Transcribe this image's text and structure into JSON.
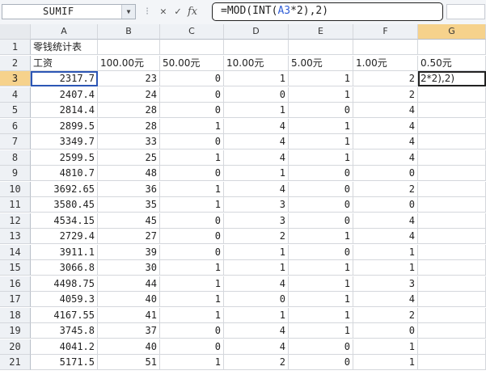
{
  "name_box": "SUMIF",
  "formula_bar": {
    "prefix": "=MOD(INT(",
    "ref": "A3",
    "suffix": "*2),2)",
    "cancel_icon": "x-icon",
    "enter_icon": "check-icon",
    "fx_label": "fx"
  },
  "columns": [
    "A",
    "B",
    "C",
    "D",
    "E",
    "F",
    "G"
  ],
  "active_column": "G",
  "active_row": 3,
  "edit_text": "2*2),2)",
  "rows": [
    {
      "n": "1",
      "cells": [
        "零钱统计表",
        "",
        "",
        "",
        "",
        "",
        ""
      ]
    },
    {
      "n": "2",
      "cells": [
        "工资",
        "100.00元",
        "50.00元",
        "10.00元",
        "5.00元",
        "1.00元",
        "0.50元"
      ]
    },
    {
      "n": "3",
      "cells": [
        "2317.7",
        "23",
        "0",
        "1",
        "1",
        "2",
        ""
      ]
    },
    {
      "n": "4",
      "cells": [
        "2407.4",
        "24",
        "0",
        "0",
        "1",
        "2",
        ""
      ]
    },
    {
      "n": "5",
      "cells": [
        "2814.4",
        "28",
        "0",
        "1",
        "0",
        "4",
        ""
      ]
    },
    {
      "n": "6",
      "cells": [
        "2899.5",
        "28",
        "1",
        "4",
        "1",
        "4",
        ""
      ]
    },
    {
      "n": "7",
      "cells": [
        "3349.7",
        "33",
        "0",
        "4",
        "1",
        "4",
        ""
      ]
    },
    {
      "n": "8",
      "cells": [
        "2599.5",
        "25",
        "1",
        "4",
        "1",
        "4",
        ""
      ]
    },
    {
      "n": "9",
      "cells": [
        "4810.7",
        "48",
        "0",
        "1",
        "0",
        "0",
        ""
      ]
    },
    {
      "n": "10",
      "cells": [
        "3692.65",
        "36",
        "1",
        "4",
        "0",
        "2",
        ""
      ]
    },
    {
      "n": "11",
      "cells": [
        "3580.45",
        "35",
        "1",
        "3",
        "0",
        "0",
        ""
      ]
    },
    {
      "n": "12",
      "cells": [
        "4534.15",
        "45",
        "0",
        "3",
        "0",
        "4",
        ""
      ]
    },
    {
      "n": "13",
      "cells": [
        "2729.4",
        "27",
        "0",
        "2",
        "1",
        "4",
        ""
      ]
    },
    {
      "n": "14",
      "cells": [
        "3911.1",
        "39",
        "0",
        "1",
        "0",
        "1",
        ""
      ]
    },
    {
      "n": "15",
      "cells": [
        "3066.8",
        "30",
        "1",
        "1",
        "1",
        "1",
        ""
      ]
    },
    {
      "n": "16",
      "cells": [
        "4498.75",
        "44",
        "1",
        "4",
        "1",
        "3",
        ""
      ]
    },
    {
      "n": "17",
      "cells": [
        "4059.3",
        "40",
        "1",
        "0",
        "1",
        "4",
        ""
      ]
    },
    {
      "n": "18",
      "cells": [
        "4167.55",
        "41",
        "1",
        "1",
        "1",
        "2",
        ""
      ]
    },
    {
      "n": "19",
      "cells": [
        "3745.8",
        "37",
        "0",
        "4",
        "1",
        "0",
        ""
      ]
    },
    {
      "n": "20",
      "cells": [
        "4041.2",
        "40",
        "0",
        "4",
        "0",
        "1",
        ""
      ]
    },
    {
      "n": "21",
      "cells": [
        "5171.5",
        "51",
        "1",
        "2",
        "0",
        "1",
        ""
      ]
    }
  ]
}
